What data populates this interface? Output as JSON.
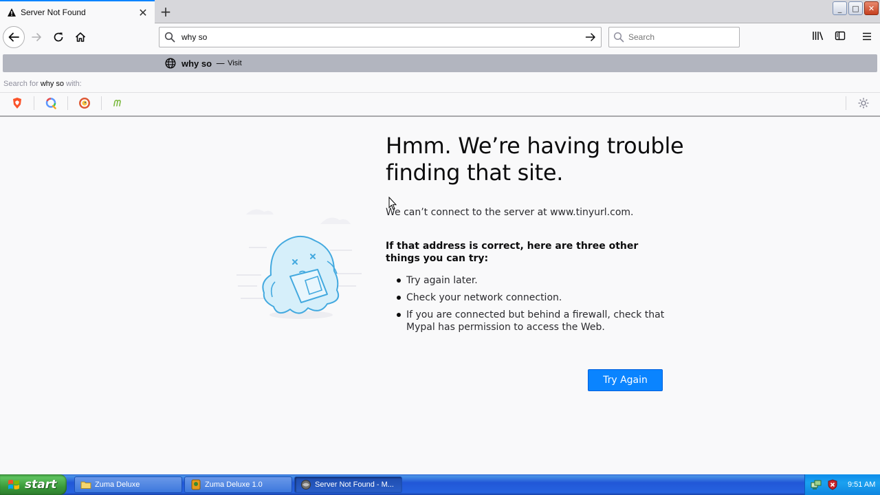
{
  "window": {
    "tab_title": "Server Not Found",
    "tab_close_symbol": "✕",
    "new_tab_symbol": "+",
    "controls": {
      "minimize": "_",
      "maximize": "□",
      "close": "✕"
    }
  },
  "toolbar": {
    "url_value": "why so ",
    "search_placeholder": "Search"
  },
  "dropdown": {
    "suggestion_text": "why so",
    "suggestion_separator": "—",
    "suggestion_action": "Visit",
    "search_for_prefix": "Search for",
    "search_for_query": "why so",
    "search_for_suffix": "with:",
    "engines": [
      "brave-engine-icon",
      "qwant-engine-icon",
      "duckduckgo-engine-icon",
      "mojeek-engine-icon"
    ]
  },
  "error_page": {
    "title": "Hmm. We’re having trouble finding that site.",
    "description": "We can’t connect to the server at www.tinyurl.com.",
    "tips_heading": "If that address is correct, here are three other things you can try:",
    "tips": [
      "Try again later.",
      "Check your network connection.",
      "If you are connected but behind a firewall, check that Mypal has permission to access the Web."
    ],
    "try_again_label": "Try Again"
  },
  "taskbar": {
    "start_label": "start",
    "tasks": [
      {
        "label": "Zuma Deluxe"
      },
      {
        "label": "Zuma Deluxe 1.0"
      },
      {
        "label": "Server Not Found - M..."
      }
    ],
    "clock": "9:51 AM"
  },
  "colors": {
    "accent": "#0a84ff",
    "suggestion_highlight": "#b2b5bf",
    "taskbar_blue": "#245edb",
    "start_green": "#3a9a3a"
  }
}
